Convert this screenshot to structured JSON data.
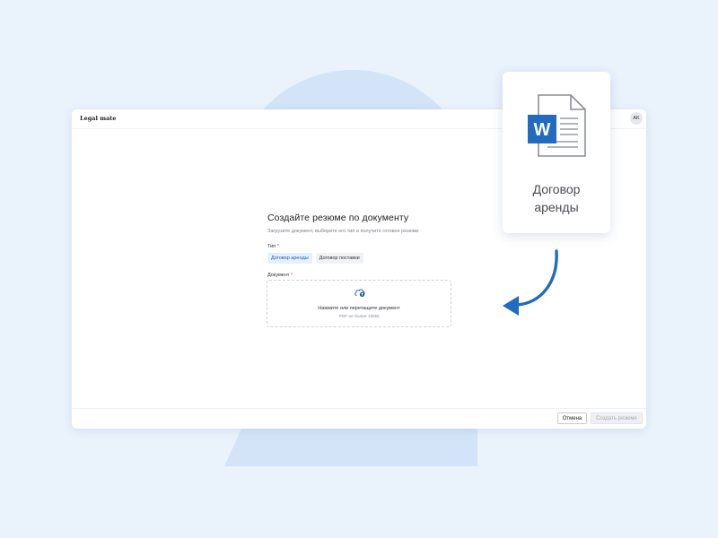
{
  "app": {
    "logo": "Legal mate",
    "avatar_initials": "AK"
  },
  "form": {
    "title": "Создайте резюме по документу",
    "subtitle": "Загрузите документ, выберите его тип и получите готовое резюме",
    "type_label": "Тип",
    "required_mark": "*",
    "type_options": [
      {
        "label": "Договор аренды",
        "selected": true
      },
      {
        "label": "Договор поставки",
        "selected": false
      }
    ],
    "document_label": "Документ"
  },
  "dropzone": {
    "icon": "cloud-upload-icon",
    "main_text": "Нажмите или перетащите документ",
    "hint_text": "PDF не более 10МБ"
  },
  "footer": {
    "cancel_label": "Отмена",
    "create_label": "Создать резюме"
  },
  "doc_card": {
    "icon": "word-document-icon",
    "icon_letter": "W",
    "name_line1": "Договор",
    "name_line2": "аренды"
  },
  "colors": {
    "accent": "#1e5fa8",
    "word_blue": "#1f6cc1",
    "background": "#eaf2fc"
  }
}
